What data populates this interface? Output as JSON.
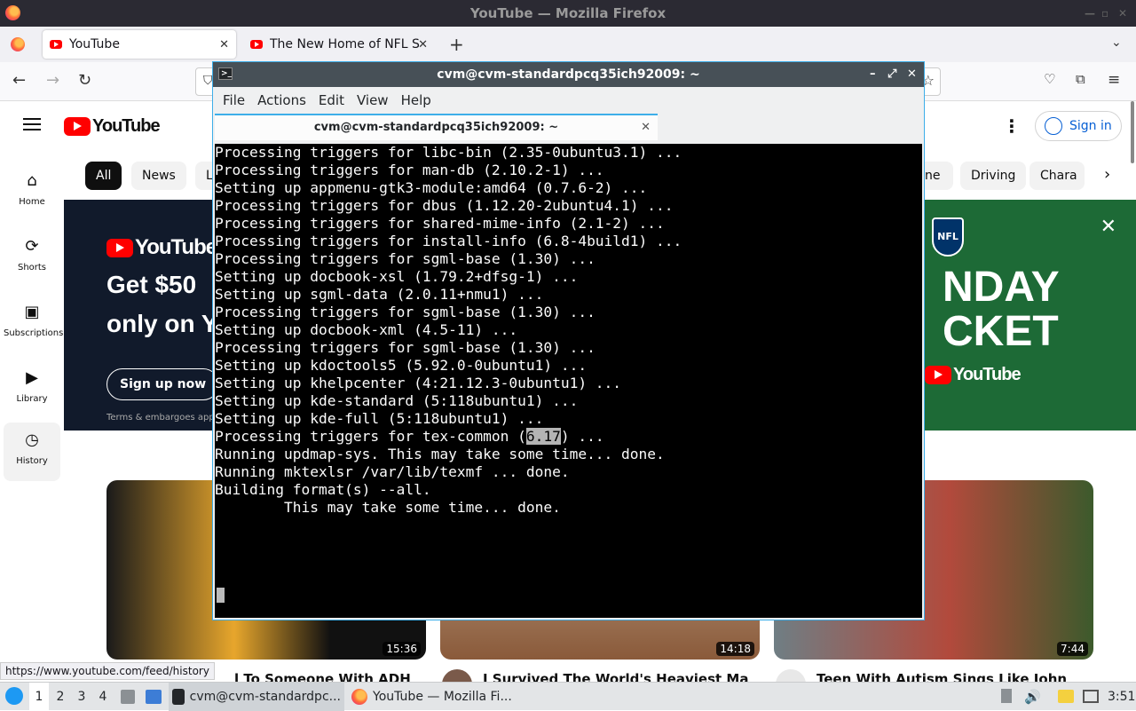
{
  "window_title": "YouTube — Mozilla Firefox",
  "tabs": [
    {
      "title": "YouTube"
    },
    {
      "title": "The New Home of NFL Su"
    }
  ],
  "youtube": {
    "logo": "YouTube",
    "sign_in": "Sign in",
    "sidebar": [
      {
        "label": "Home",
        "icon": "home-icon"
      },
      {
        "label": "Shorts",
        "icon": "shorts-icon"
      },
      {
        "label": "Subscriptions",
        "icon": "subscriptions-icon"
      },
      {
        "label": "Library",
        "icon": "library-icon"
      },
      {
        "label": "History",
        "icon": "history-icon"
      }
    ],
    "chips": [
      "All",
      "News",
      "L",
      "ne",
      "Driving",
      "Chara"
    ],
    "banner": {
      "brand": "YouTube",
      "line1": "Get $50",
      "line2": "only on Y",
      "cta": "Sign up now",
      "terms": "Terms & embargoes app",
      "right_text1": "NDAY",
      "right_text2": "CKET",
      "right_brand": "YouTube",
      "nfl": "NFL"
    },
    "videos": [
      {
        "title": "l To Someone With ADHD",
        "duration": "15:36"
      },
      {
        "title": "I Survived The World's Heaviest Man's",
        "duration": "14:18"
      },
      {
        "title": "Teen With Autism Sings Like John",
        "duration": "7:44"
      }
    ],
    "status_url": "https://www.youtube.com/feed/history"
  },
  "terminal": {
    "title": "cvm@cvm-standardpcq35ich92009: ~",
    "tab_title": "cvm@cvm-standardpcq35ich92009: ~",
    "menu": [
      "File",
      "Actions",
      "Edit",
      "View",
      "Help"
    ],
    "lines": [
      "Processing triggers for libc-bin (2.35-0ubuntu3.1) ...",
      "Processing triggers for man-db (2.10.2-1) ...",
      "Setting up appmenu-gtk3-module:amd64 (0.7.6-2) ...",
      "Processing triggers for dbus (1.12.20-2ubuntu4.1) ...",
      "Processing triggers for shared-mime-info (2.1-2) ...",
      "Processing triggers for install-info (6.8-4build1) ...",
      "Processing triggers for sgml-base (1.30) ...",
      "Setting up docbook-xsl (1.79.2+dfsg-1) ...",
      "Setting up sgml-data (2.0.11+nmu1) ...",
      "Processing triggers for sgml-base (1.30) ...",
      "Setting up docbook-xml (4.5-11) ...",
      "Processing triggers for sgml-base (1.30) ...",
      "Setting up kdoctools5 (5.92.0-0ubuntu1) ...",
      "Setting up khelpcenter (4:21.12.3-0ubuntu1) ...",
      "Setting up kde-standard (5:118ubuntu1) ...",
      "Setting up kde-full (5:118ubuntu1) ...",
      "Processing triggers for tex-common (",
      "Running updmap-sys. This may take some time... done.",
      "Running mktexlsr /var/lib/texmf ... done.",
      "Building format(s) --all.",
      "        This may take some time... done."
    ],
    "selected_text": "6.17",
    "after_selection": ") ..."
  },
  "taskbar": {
    "desktops": [
      "1",
      "2",
      "3",
      "4"
    ],
    "tasks": [
      {
        "label": "cvm@cvm-standardpc..."
      },
      {
        "label": "YouTube — Mozilla Fi..."
      }
    ],
    "clock": "3:51"
  }
}
